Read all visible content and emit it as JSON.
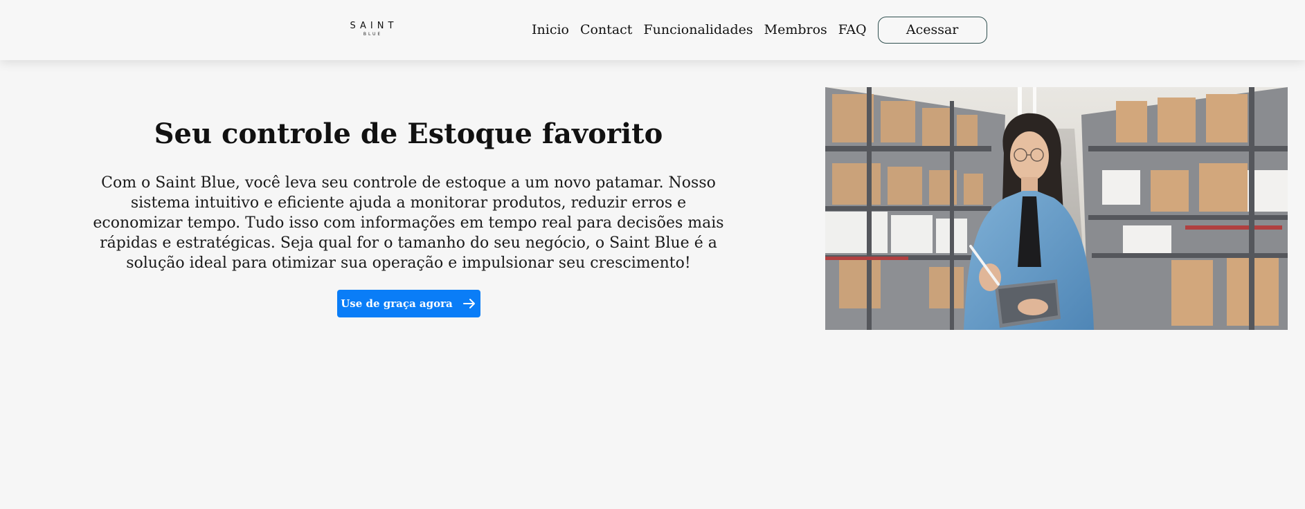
{
  "brand": {
    "name": "SAINT",
    "sub": "BLUE"
  },
  "nav": {
    "links": [
      "Inicio",
      "Contact",
      "Funcionalidades",
      "Membros",
      "FAQ"
    ],
    "login_label": "Acessar"
  },
  "hero": {
    "title": "Seu controle de Estoque favorito",
    "description": "Com o Saint Blue, você leva seu controle de estoque a um novo patamar. Nosso sistema intuitivo e eficiente ajuda a monitorar produtos, reduzir erros e economizar tempo. Tudo isso com informações em tempo real para decisões mais rápidas e estratégicas. Seja qual for o tamanho do seu negócio, o Saint Blue é a solução ideal para otimizar sua operação e impulsionar seu crescimento!",
    "cta_label": "Use de graça agora",
    "cta_icon": "arrow-right-icon"
  },
  "colors": {
    "background": "#f6f6f6",
    "accent": "#0a7df7",
    "button_border": "#2f4f4f"
  }
}
